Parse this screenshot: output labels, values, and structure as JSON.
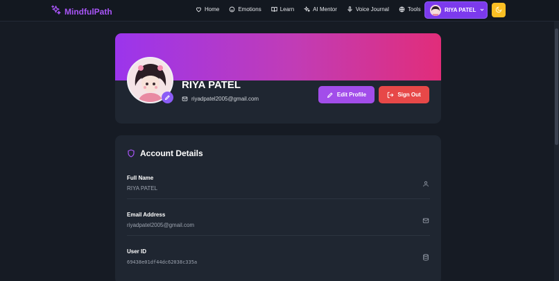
{
  "nav": {
    "brand": "MindfulPath",
    "links": [
      {
        "label": "Home",
        "icon": "heart-icon"
      },
      {
        "label": "Emotions",
        "icon": "smile-icon"
      },
      {
        "label": "Learn",
        "icon": "book-icon"
      },
      {
        "label": "AI Mentor",
        "icon": "sparkles-icon"
      },
      {
        "label": "Voice Journal",
        "icon": "microphone-icon"
      },
      {
        "label": "Tools",
        "icon": "globe-icon"
      }
    ],
    "user_name": "RIYA PATEL",
    "theme_icon": "moon-icon"
  },
  "profile": {
    "name": "RIYA PATEL",
    "email": "riyadpatel2005@gmail.com",
    "edit_label": "Edit Profile",
    "signout_label": "Sign Out"
  },
  "account": {
    "title": "Account Details",
    "rows": [
      {
        "label": "Full Name",
        "value": "RIYA PATEL",
        "icon": "user-icon"
      },
      {
        "label": "Email Address",
        "value": "riyadpatel2005@gmail.com",
        "icon": "mail-icon"
      },
      {
        "label": "User ID",
        "value": "69438e01df44dc62038c335a",
        "icon": "database-icon"
      }
    ]
  },
  "colors": {
    "accent": "#a855f7",
    "gradient_start": "#9b35ec",
    "gradient_end": "#e12d7a",
    "danger": "#e74848",
    "theme_button": "#fbbf24"
  }
}
